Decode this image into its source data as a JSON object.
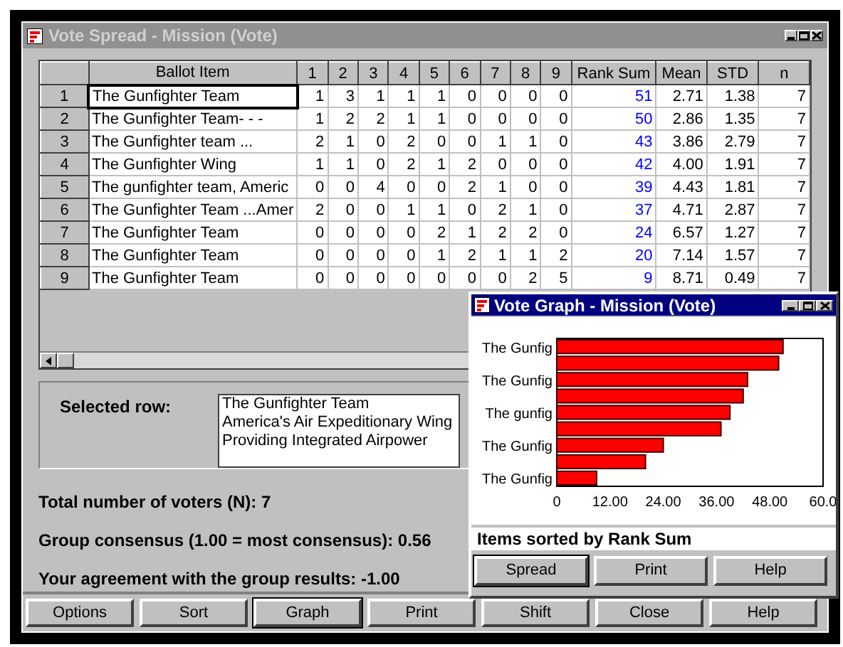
{
  "main_window": {
    "title": "Vote Spread - Mission (Vote)",
    "active": false
  },
  "table": {
    "columns": [
      "Ballot Item",
      "1",
      "2",
      "3",
      "4",
      "5",
      "6",
      "7",
      "8",
      "9",
      "Rank Sum",
      "Mean",
      "STD",
      "n"
    ],
    "rows": [
      {
        "number": "1",
        "ballot_item": "The Gunfighter Team",
        "counts": [
          "1",
          "3",
          "1",
          "1",
          "1",
          "0",
          "0",
          "0",
          "0"
        ],
        "rank_sum": "51",
        "mean": "2.71",
        "std": "1.38",
        "n": "7",
        "selected": true
      },
      {
        "number": "2",
        "ballot_item": "The Gunfighter Team- - -",
        "counts": [
          "1",
          "2",
          "2",
          "1",
          "1",
          "0",
          "0",
          "0",
          "0"
        ],
        "rank_sum": "50",
        "mean": "2.86",
        "std": "1.35",
        "n": "7",
        "selected": false
      },
      {
        "number": "3",
        "ballot_item": "The Gunfighter team ...",
        "counts": [
          "2",
          "1",
          "0",
          "2",
          "0",
          "0",
          "1",
          "1",
          "0"
        ],
        "rank_sum": "43",
        "mean": "3.86",
        "std": "2.79",
        "n": "7",
        "selected": false
      },
      {
        "number": "4",
        "ballot_item": "The Gunfighter Wing",
        "counts": [
          "1",
          "1",
          "0",
          "2",
          "1",
          "2",
          "0",
          "0",
          "0"
        ],
        "rank_sum": "42",
        "mean": "4.00",
        "std": "1.91",
        "n": "7",
        "selected": false
      },
      {
        "number": "5",
        "ballot_item": "The gunfighter team,  Americ",
        "counts": [
          "0",
          "0",
          "4",
          "0",
          "0",
          "2",
          "1",
          "0",
          "0"
        ],
        "rank_sum": "39",
        "mean": "4.43",
        "std": "1.81",
        "n": "7",
        "selected": false
      },
      {
        "number": "6",
        "ballot_item": "The Gunfighter Team ...Amer",
        "counts": [
          "2",
          "0",
          "0",
          "1",
          "1",
          "0",
          "2",
          "1",
          "0"
        ],
        "rank_sum": "37",
        "mean": "4.71",
        "std": "2.87",
        "n": "7",
        "selected": false
      },
      {
        "number": "7",
        "ballot_item": "The Gunfighter Team",
        "counts": [
          "0",
          "0",
          "0",
          "0",
          "2",
          "1",
          "2",
          "2",
          "0"
        ],
        "rank_sum": "24",
        "mean": "6.57",
        "std": "1.27",
        "n": "7",
        "selected": false
      },
      {
        "number": "8",
        "ballot_item": "The Gunfighter Team",
        "counts": [
          "0",
          "0",
          "0",
          "0",
          "1",
          "2",
          "1",
          "1",
          "2"
        ],
        "rank_sum": "20",
        "mean": "7.14",
        "std": "1.57",
        "n": "7",
        "selected": false
      },
      {
        "number": "9",
        "ballot_item": "The Gunfighter Team",
        "counts": [
          "0",
          "0",
          "0",
          "0",
          "0",
          "0",
          "0",
          "2",
          "5"
        ],
        "rank_sum": "9",
        "mean": "8.71",
        "std": "0.49",
        "n": "7",
        "selected": false
      }
    ]
  },
  "selected_row": {
    "label": "Selected row:",
    "lines": [
      "The Gunfighter Team",
      "America's Air Expeditionary Wing",
      "Providing Integrated Airpower"
    ]
  },
  "stats": [
    "Total number of voters (N):  7",
    "Group consensus (1.00 = most consensus):  0.56",
    "Your agreement with the group results:  -1.00"
  ],
  "buttons": [
    {
      "label": "Options",
      "default": false
    },
    {
      "label": "Sort",
      "default": false
    },
    {
      "label": "Graph",
      "default": true
    },
    {
      "label": "Print",
      "default": false
    },
    {
      "label": "Shift",
      "default": false
    },
    {
      "label": "Close",
      "default": false
    },
    {
      "label": "Help",
      "default": false
    }
  ],
  "graph_window": {
    "title": "Vote Graph - Mission (Vote)",
    "active": true,
    "chart_data": {
      "type": "bar",
      "orientation": "horizontal",
      "categories": [
        "The Gunfig",
        null,
        "The Gunfig",
        null,
        "The gunfig",
        null,
        "The Gunfig",
        null,
        "The Gunfig"
      ],
      "series": [
        {
          "color": "#ff0000",
          "values": [
            51,
            50,
            43,
            42,
            39,
            37,
            24,
            20,
            9
          ]
        }
      ],
      "xlim": [
        0,
        60
      ],
      "xticks": [
        0,
        {
          "value": 12,
          "label": "12.00"
        },
        {
          "value": 24,
          "label": "24.00"
        },
        {
          "value": 36,
          "label": "36.00"
        },
        {
          "value": 48,
          "label": "48.00"
        },
        {
          "value": 60,
          "label": "60.0"
        }
      ]
    },
    "caption": "Items sorted by Rank Sum",
    "buttons": [
      {
        "label": "Spread",
        "default": true
      },
      {
        "label": "Print",
        "default": false
      },
      {
        "label": "Help",
        "default": false
      }
    ]
  }
}
